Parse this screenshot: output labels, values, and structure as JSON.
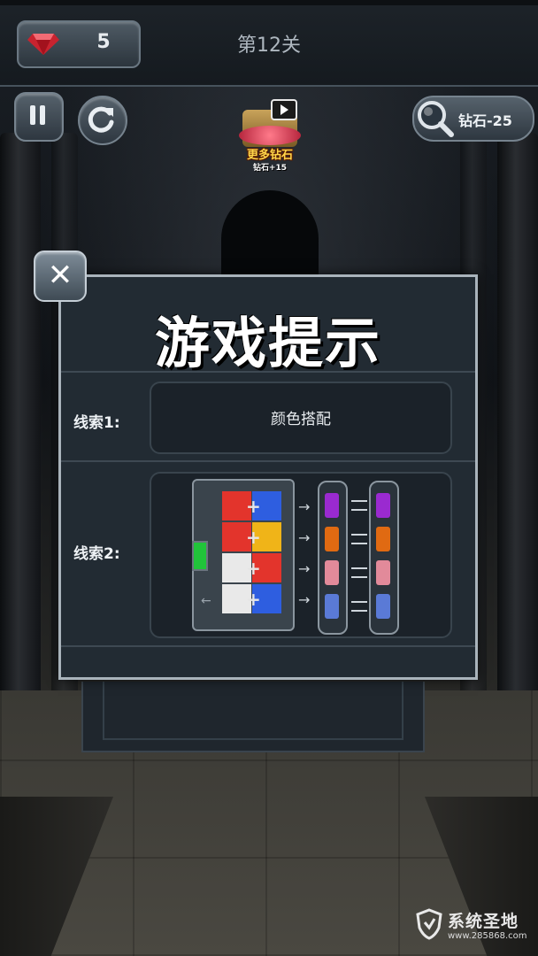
{
  "header": {
    "gem_count": "5",
    "level_title": "第12关"
  },
  "controls": {
    "pause_icon": "pause-icon",
    "restart_icon": "restart-icon",
    "hint_button_label": "钻石-25",
    "promo": {
      "title": "更多钻石",
      "subtitle": "钻石+15"
    }
  },
  "dialog": {
    "title": "游戏提示",
    "close_symbol": "✕",
    "clue1": {
      "label": "线索1:",
      "text": "颜色搭配"
    },
    "clue2": {
      "label": "线索2:",
      "grid_left": [
        "red",
        "red",
        "white",
        "white"
      ],
      "grid_right": [
        "blue",
        "yellow",
        "red",
        "blue"
      ],
      "vial_colors": [
        "#9a2ad0",
        "#e06a12",
        "#e28a9a",
        "#5a7ad6"
      ]
    }
  },
  "watermark": {
    "brand": "系统圣地",
    "url": "www.285868.com"
  },
  "colors": {
    "red": "#e3342c",
    "blue": "#2e5ee0",
    "yellow": "#f0b418",
    "white": "#e9e9e9",
    "dialog_border": "#a9b3bb"
  }
}
